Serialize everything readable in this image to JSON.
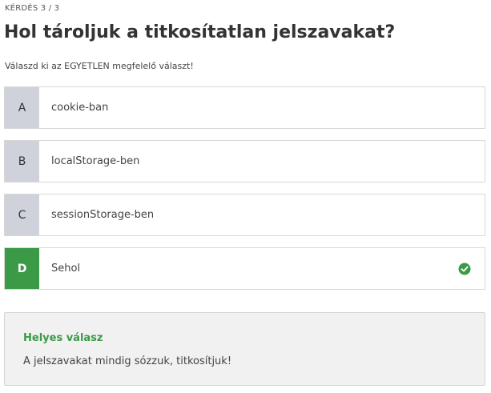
{
  "question": {
    "counter": "KÉRDÉS 3 / 3",
    "title": "Hol tároljuk a titkosítatlan jelszavakat?",
    "instruction": "Válaszd ki az EGYETLEN megfelelő választ!"
  },
  "options": [
    {
      "letter": "A",
      "text": "cookie-ban",
      "correct": false
    },
    {
      "letter": "B",
      "text": "localStorage-ben",
      "correct": false
    },
    {
      "letter": "C",
      "text": "sessionStorage-ben",
      "correct": false
    },
    {
      "letter": "D",
      "text": "Sehol",
      "correct": true,
      "icon": "check-circle-icon"
    }
  ],
  "feedback": {
    "title": "Helyes válasz",
    "text": "A jelszavakat mindig sózzuk, titkosítjuk!"
  },
  "colors": {
    "correct": "#3a9a46",
    "letter_bg": "#cfd2da",
    "feedback_bg": "#f1f1f1"
  }
}
